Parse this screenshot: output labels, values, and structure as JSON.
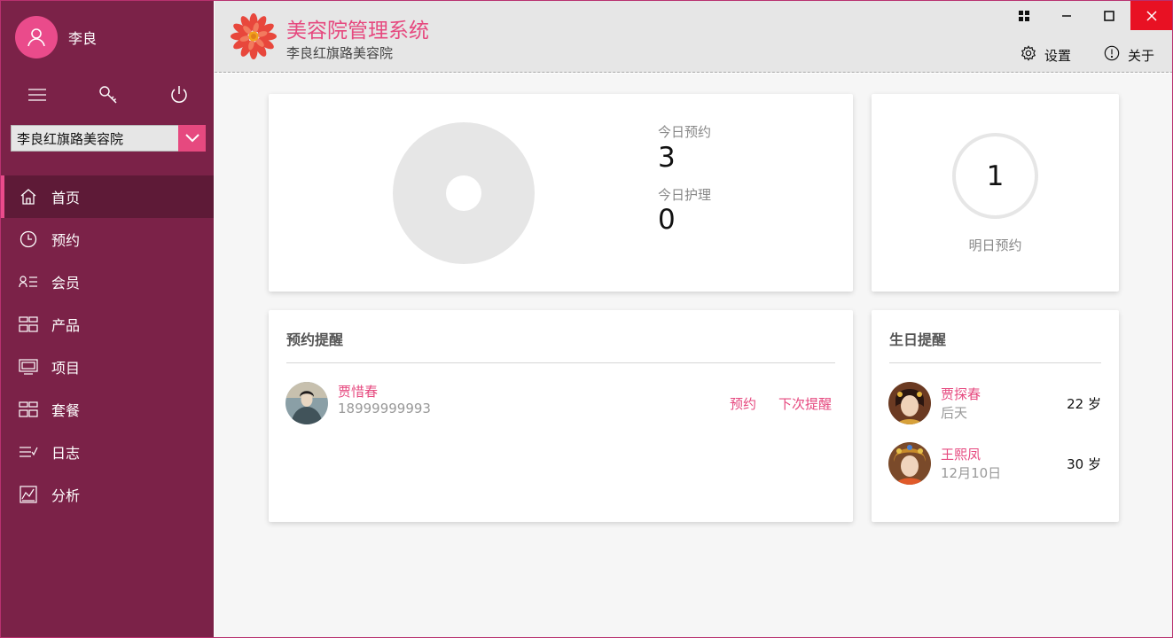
{
  "user": {
    "name": "李良"
  },
  "store_select": {
    "value": "李良红旗路美容院"
  },
  "nav": [
    {
      "label": "首页",
      "icon": "home-icon"
    },
    {
      "label": "预约",
      "icon": "clock-icon"
    },
    {
      "label": "会员",
      "icon": "member-list-icon"
    },
    {
      "label": "产品",
      "icon": "product-grid-icon"
    },
    {
      "label": "项目",
      "icon": "monitor-icon"
    },
    {
      "label": "套餐",
      "icon": "package-grid-icon"
    },
    {
      "label": "日志",
      "icon": "log-list-icon"
    },
    {
      "label": "分析",
      "icon": "chart-icon"
    }
  ],
  "header": {
    "title": "美容院管理系统",
    "subtitle": "李良红旗路美容院",
    "settings_label": "设置",
    "about_label": "关于"
  },
  "today": {
    "appointments_label": "今日预约",
    "appointments_value": "3",
    "care_label": "今日护理",
    "care_value": "0"
  },
  "tomorrow": {
    "value": "1",
    "label": "明日预约"
  },
  "appointment_reminders": {
    "title": "预约提醒",
    "items": [
      {
        "name": "贾惜春",
        "phone": "18999999993",
        "action1": "预约",
        "action2": "下次提醒"
      }
    ]
  },
  "birthday_reminders": {
    "title": "生日提醒",
    "items": [
      {
        "name": "贾探春",
        "date": "后天",
        "age": "22 岁"
      },
      {
        "name": "王熙凤",
        "date": "12月10日",
        "age": "30 岁"
      }
    ]
  },
  "colors": {
    "sidebar": "#7b2248",
    "sidebar_active": "#5e1a37",
    "accent": "#e6497f",
    "close": "#e81123"
  }
}
